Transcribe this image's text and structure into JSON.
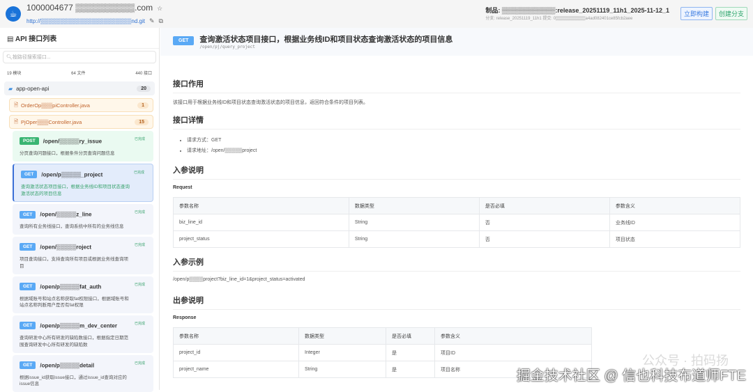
{
  "repo": {
    "name": "1000004677 ▒▒▒▒▒▒▒▒▒▒.com",
    "url": "http://▒▒▒▒▒▒▒▒▒▒▒▒▒▒▒▒▒▒▒▒▒▒▒nd.git"
  },
  "artifact": {
    "line1": "制品: ▒▒▒▒▒▒▒▒▒▒▒▒:release_20251119_11h1_2025-11-12_1",
    "line2": "分支: release_20251119_11h1 提交: 0▒▒▒▒▒▒▒▒▒▒a4ad082401ce85fcb2aee"
  },
  "buttons": {
    "build": "立即构建",
    "branch": "创建分支"
  },
  "sidebar": {
    "title": "API 接口列表",
    "search_placeholder": "按路径搜索接口...",
    "stats": {
      "modules": "19 模块",
      "files": "64 文件",
      "apis": "440 接口"
    },
    "module": {
      "name": "app-open-api",
      "count": "20"
    },
    "files": [
      {
        "name": "OrderOp▒▒▒piController.java",
        "count": "1"
      },
      {
        "name": "PjOper▒▒▒Controller.java",
        "count": "15"
      }
    ],
    "endpoints": [
      {
        "method": "POST",
        "path": "/open/▒▒▒▒▒ry_issue",
        "status": "已完成",
        "desc": "分页查询问题接口，根据条件分页查询问题信息"
      },
      {
        "method": "GET",
        "path": "/open/p▒▒▒▒▒_project",
        "status": "已完成",
        "desc": "查询激活状态项目接口，根据业务线ID和项目状态查询激活状态的项目信息"
      },
      {
        "method": "GET",
        "path": "/open/▒▒▒▒▒z_line",
        "status": "已完成",
        "desc": "查询所有业务线接口，查询系统中所有的业务线信息"
      },
      {
        "method": "GET",
        "path": "/open/▒▒▒▒▒roject",
        "status": "已完成",
        "desc": "项目查询接口，支持查询所有项目或根据业务线查询项目"
      },
      {
        "method": "GET",
        "path": "/open/p▒▒▒▒▒fat_auth",
        "status": "已完成",
        "desc": "根据域账号和站点名称获取fat权限接口，根据域账号和站点名称判断用户是否有fat权限"
      },
      {
        "method": "GET",
        "path": "/open/p▒▒▒▒▒m_dev_center",
        "status": "已完成",
        "desc": "查询研发中心所有研发的缺陷数接口，根据指定日期范围查询研发中心所有研发的缺陷数"
      },
      {
        "method": "GET",
        "path": "/open/p▒▒▒▒▒detail",
        "status": "已完成",
        "desc": "根据issue_id获取issue接口，通过issue_id查询对应的issue信息"
      }
    ]
  },
  "main": {
    "method": "GET",
    "title": "查询激活状态项目接口，根据业务线ID和项目状态查询激活状态的项目信息",
    "path": "/open/pj/query_project",
    "s1": "接口作用",
    "s1_text": "该接口用于根据业务线ID和项目状态查询激活状态的项目信息，返回符合条件的项目列表。",
    "s2": "接口详情",
    "detail_method": "请求方式：GET",
    "detail_url": "请求地址：/open/▒▒▒▒▒project",
    "s3": "入参说明",
    "req_label": "Request",
    "req_headers": [
      "参数名称",
      "数据类型",
      "是否必填",
      "参数含义"
    ],
    "req_rows": [
      [
        "biz_line_id",
        "String",
        "否",
        "业务线ID"
      ],
      [
        "project_status",
        "String",
        "否",
        "项目状态"
      ]
    ],
    "s4": "入参示例",
    "example": "/open/p▒▒▒▒project?biz_line_id=1&project_status=activated",
    "s5": "出参说明",
    "resp_label": "Response",
    "resp_headers": [
      "参数名称",
      "数据类型",
      "是否必填",
      "参数含义"
    ],
    "resp_rows": [
      [
        "project_id",
        "Integer",
        "是",
        "项目ID"
      ],
      [
        "project_name",
        "String",
        "是",
        "项目名称"
      ]
    ]
  },
  "watermark": {
    "wechat": "公众号 · 拍码扬",
    "juejin": "掘金技术社区 @ 信也科技布道师FTE"
  }
}
